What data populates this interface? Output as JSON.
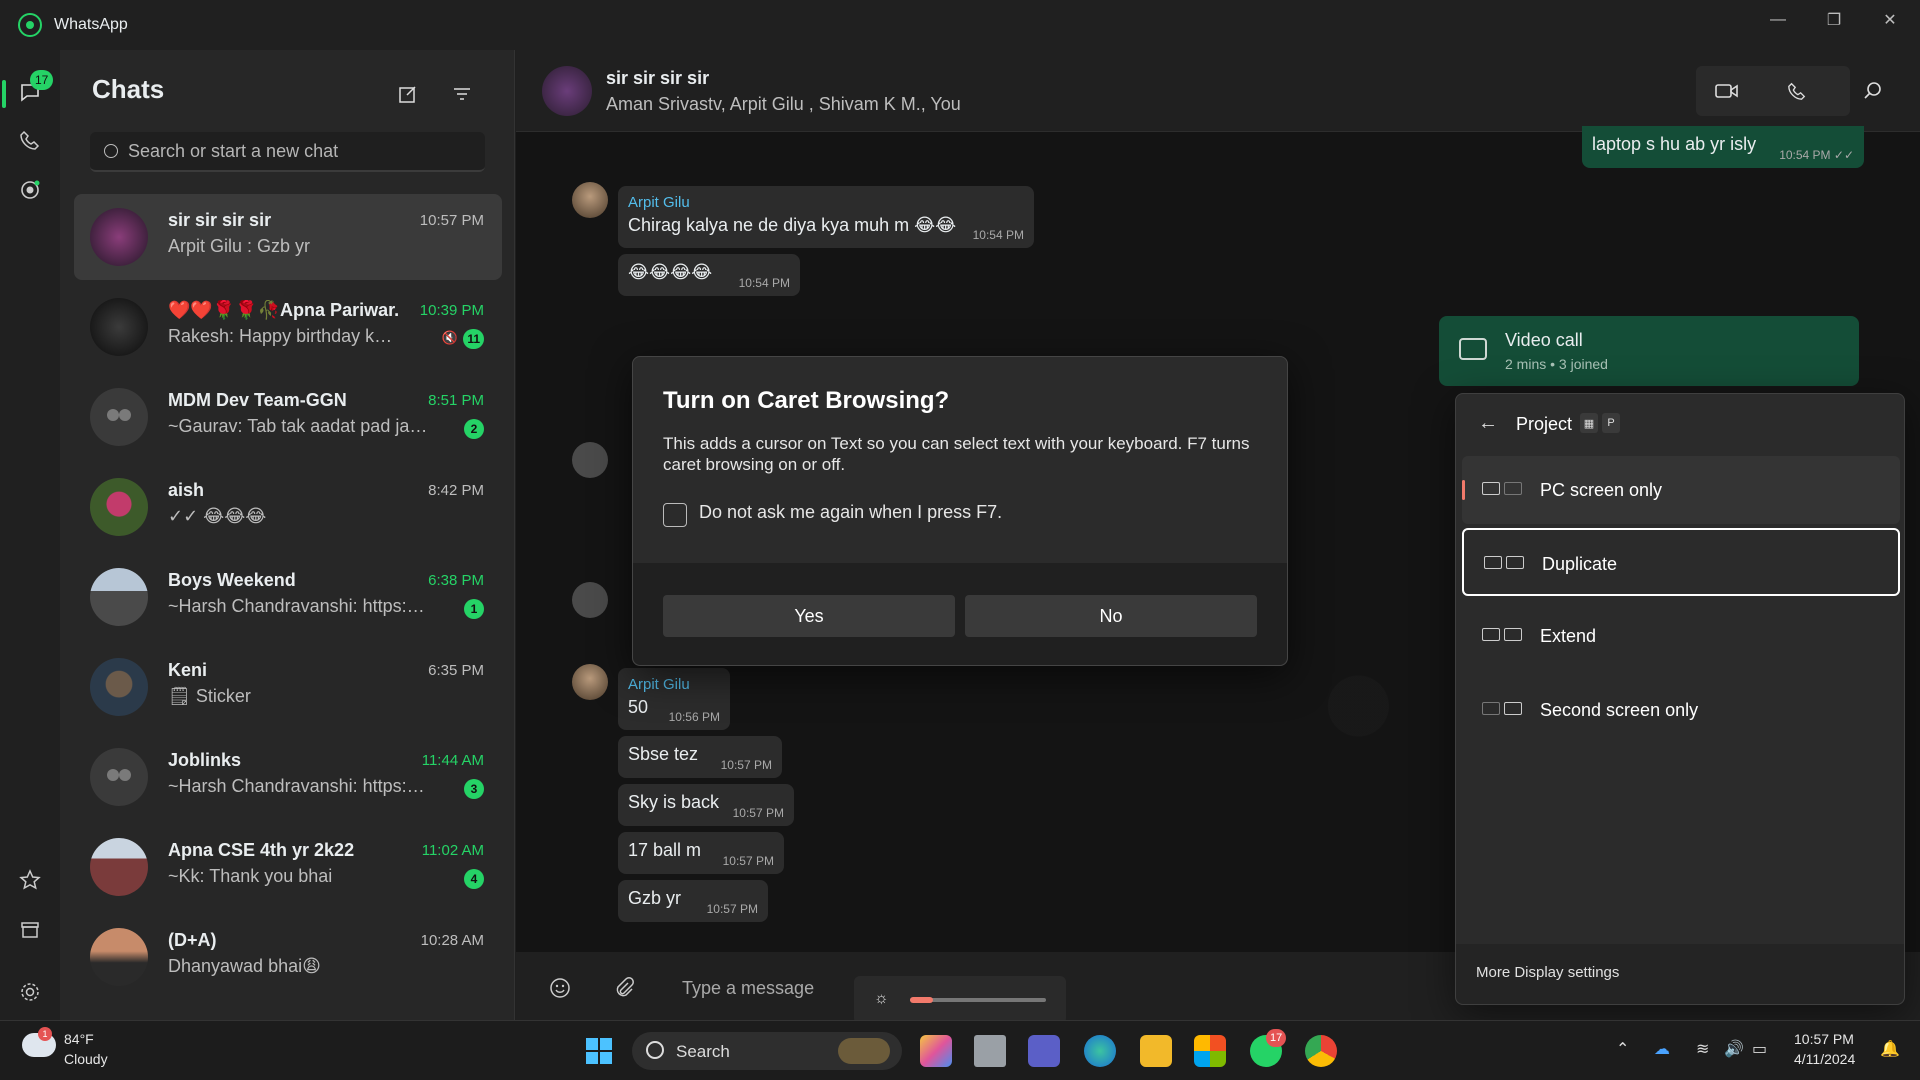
{
  "window": {
    "title": "WhatsApp"
  },
  "rail": {
    "chats_badge": "17"
  },
  "chatlist": {
    "title": "Chats",
    "search_placeholder": "Search or start a new chat",
    "items": [
      {
        "name": "sir sir sir sir",
        "msg": "Arpit Gilu : Gzb yr",
        "time": "10:57 PM",
        "badge": "",
        "unread": false
      },
      {
        "name": "❤️❤️🌹🌹🥀Apna Pariwar...",
        "msg": "Rakesh: Happy birthday kannu...",
        "time": "10:39 PM",
        "badge": "11",
        "unread": true,
        "muted": true
      },
      {
        "name": "MDM Dev Team-GGN",
        "msg": "~Gaurav: Tab tak aadat pad jayegi",
        "time": "8:51 PM",
        "badge": "2",
        "unread": true
      },
      {
        "name": "aish",
        "msg": "✓✓ 😂😂😂",
        "time": "8:42 PM",
        "badge": "",
        "unread": false
      },
      {
        "name": "Boys Weekend",
        "msg": "~Harsh Chandravanshi: https://ge...",
        "time": "6:38 PM",
        "badge": "1",
        "unread": true
      },
      {
        "name": "Keni",
        "msg": "🗒 Sticker",
        "time": "6:35 PM",
        "badge": "",
        "unread": false
      },
      {
        "name": "Joblinks",
        "msg": "~Harsh Chandravanshi: https://ww...",
        "time": "11:44 AM",
        "badge": "3",
        "unread": true
      },
      {
        "name": "Apna CSE 4th yr 2k22",
        "msg": "~Kk: Thank you bhai",
        "time": "11:02 AM",
        "badge": "4",
        "unread": true
      },
      {
        "name": "(D+A)",
        "msg": "Dhanyawad bhai😩",
        "time": "10:28 AM",
        "badge": "",
        "unread": false
      }
    ]
  },
  "conversation": {
    "title": "sir sir sir sir",
    "members": "Aman Srivastv, Arpit Gilu , Shivam K M., You",
    "messages": {
      "m0": {
        "text": "laptop s hu ab yr isly",
        "time": "10:54 PM ✓✓"
      },
      "m1": {
        "sender": "Arpit Gilu",
        "text": "Chirag kalya ne de diya kya muh m 😂😂",
        "time": "10:54 PM"
      },
      "m2": {
        "text": "😂😂😂😂",
        "time": "10:54 PM"
      },
      "m3": {
        "sender": "Arpit Gilu",
        "text": "50",
        "time": "10:56 PM"
      },
      "m4": {
        "text": "Sbse tez",
        "time": "10:57 PM"
      },
      "m5": {
        "text": "Sky is back",
        "time": "10:57 PM"
      },
      "m6": {
        "text": "17 ball m",
        "time": "10:57 PM"
      },
      "m7": {
        "text": "Gzb yr",
        "time": "10:57 PM"
      }
    },
    "videocall": {
      "title": "Video call",
      "sub": "2 mins • 3 joined"
    },
    "composer_placeholder": "Type a message",
    "brightness_level": 0.17
  },
  "dialog": {
    "title": "Turn on Caret Browsing?",
    "body": "This adds a cursor on Text so you can select text with your keyboard. F7 turns caret browsing on or off.",
    "checkbox_label": "Do not ask me again when I press F7.",
    "yes": "Yes",
    "no": "No"
  },
  "project": {
    "title": "Project",
    "shortcut_key": "P",
    "options": {
      "pc": "PC screen only",
      "duplicate": "Duplicate",
      "extend": "Extend",
      "second": "Second screen only"
    },
    "more": "More Display settings"
  },
  "taskbar": {
    "weather_badge": "1",
    "temp": "84°F",
    "condition": "Cloudy",
    "search_label": "Search",
    "whatsapp_badge": "17",
    "time": "10:57 PM",
    "date": "4/11/2024"
  },
  "colors": {
    "accent": "#25d366",
    "outgoing": "#144d37",
    "projection_indicator": "#f27a6b"
  }
}
